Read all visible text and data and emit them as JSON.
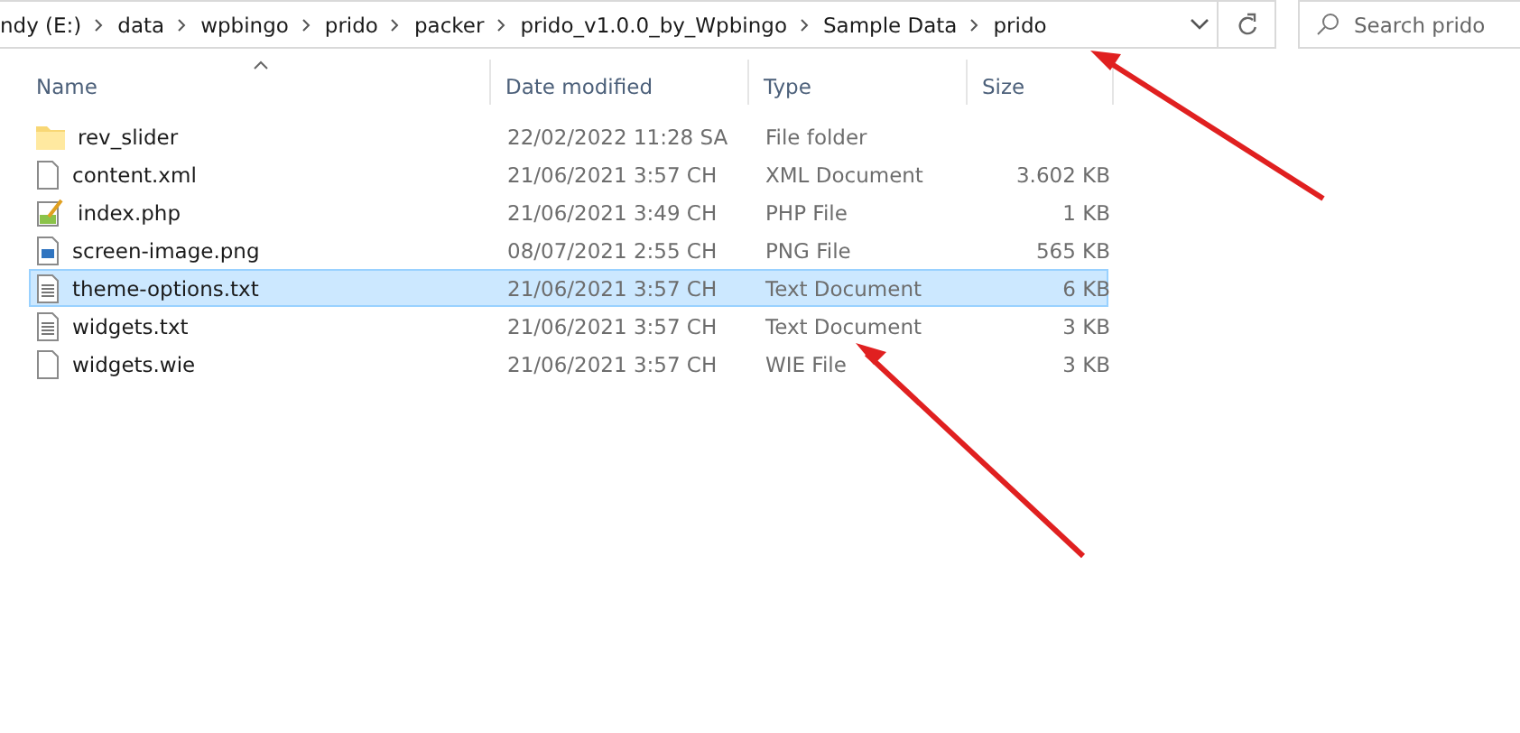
{
  "breadcrumbs": [
    "ndy (E:)",
    "data",
    "wpbingo",
    "prido",
    "packer",
    "prido_v1.0.0_by_Wpbingo",
    "Sample Data",
    "prido"
  ],
  "search": {
    "placeholder": "Search prido"
  },
  "columns": [
    {
      "label": "Name",
      "sorted": true
    },
    {
      "label": "Date modified",
      "sorted": false
    },
    {
      "label": "Type",
      "sorted": false
    },
    {
      "label": "Size",
      "sorted": false
    }
  ],
  "rows": [
    {
      "kind": "folder",
      "name": "rev_slider",
      "date": "22/02/2022 11:28 SA",
      "type": "File folder",
      "size": "",
      "selected": false
    },
    {
      "kind": "file",
      "name": "content.xml",
      "date": "21/06/2021 3:57 CH",
      "type": "XML Document",
      "size": "3.602 KB",
      "selected": false
    },
    {
      "kind": "script",
      "name": "index.php",
      "date": "21/06/2021 3:49 CH",
      "type": "PHP File",
      "size": "1 KB",
      "selected": false
    },
    {
      "kind": "image",
      "name": "screen-image.png",
      "date": "08/07/2021 2:55 CH",
      "type": "PNG File",
      "size": "565 KB",
      "selected": false
    },
    {
      "kind": "text",
      "name": "theme-options.txt",
      "date": "21/06/2021 3:57 CH",
      "type": "Text Document",
      "size": "6 KB",
      "selected": true
    },
    {
      "kind": "text",
      "name": "widgets.txt",
      "date": "21/06/2021 3:57 CH",
      "type": "Text Document",
      "size": "3 KB",
      "selected": false
    },
    {
      "kind": "file",
      "name": "widgets.wie",
      "date": "21/06/2021 3:57 CH",
      "type": "WIE File",
      "size": "3 KB",
      "selected": false
    }
  ],
  "annotations": [
    {
      "kind": "arrow"
    },
    {
      "kind": "arrow"
    }
  ]
}
